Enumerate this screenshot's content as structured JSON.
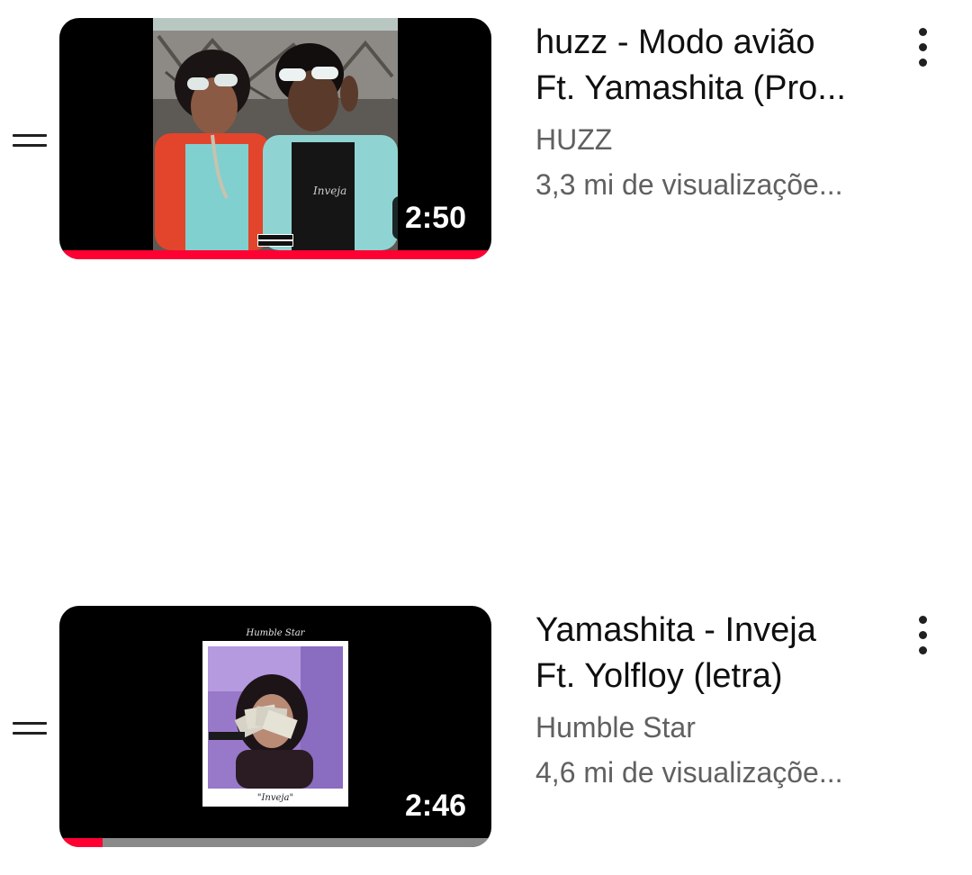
{
  "videos": [
    {
      "title_line1": "huzz - Modo avião",
      "title_line2": "Ft. Yamashita (Pro...",
      "channel": "HUZZ",
      "views": "3,3 mi de visualizaçõe...",
      "duration": "2:50",
      "watched_fraction": 1.0,
      "thumbnail_label": "PARENTAL ADVISORY",
      "handle_icon": "drag-handle-icon",
      "menu_icon": "more-vert-icon"
    },
    {
      "title_line1": "Yamashita - Inveja",
      "title_line2": "Ft. Yolfloy (letra)",
      "channel": "Humble Star",
      "views": "4,6 mi de visualizaçõe...",
      "duration": "2:46",
      "watched_fraction": 0.1,
      "thumbnail_label": "Humble Star",
      "thumbnail_caption": "\"Inveja\"",
      "handle_icon": "drag-handle-icon",
      "menu_icon": "more-vert-icon"
    }
  ],
  "colors": {
    "progress": "#ff0033",
    "progress_track": "#8a8a8a",
    "title": "#0f0f0f",
    "secondary": "#606060"
  }
}
